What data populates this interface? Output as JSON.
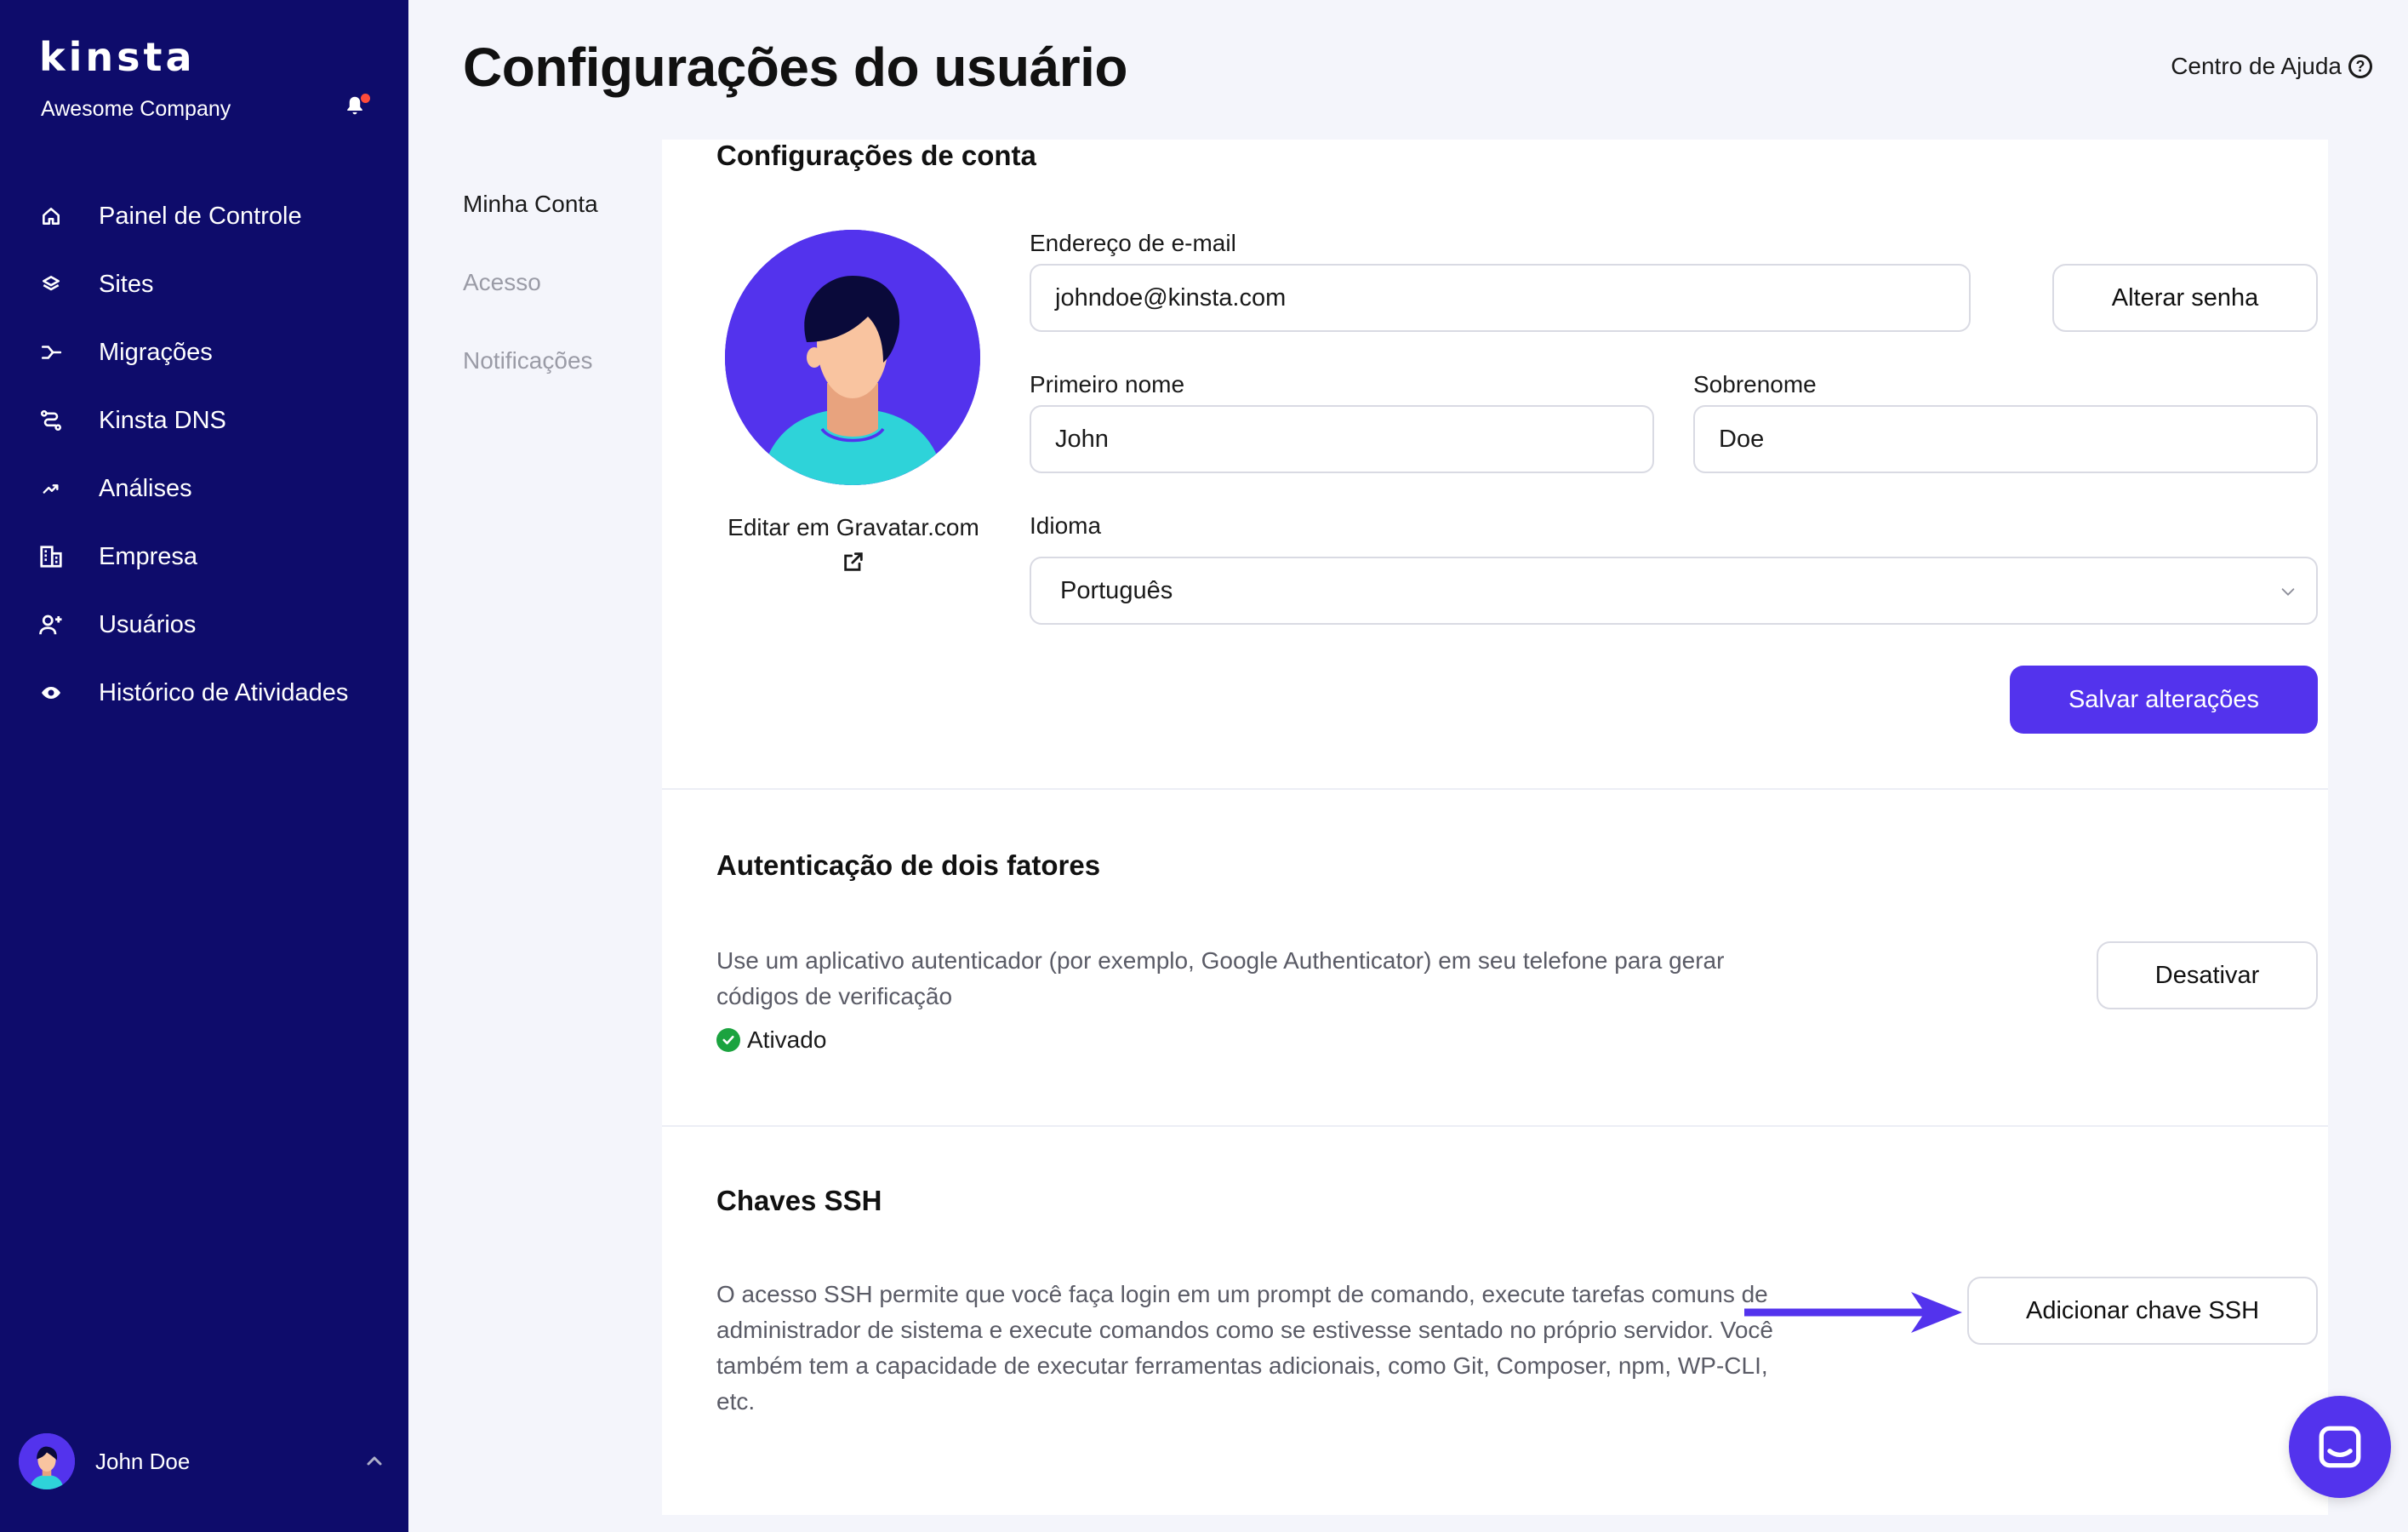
{
  "brand": {
    "logo": "kinsta",
    "company": "Awesome Company",
    "accent_color": "#5333ed",
    "sidebar_color": "#0e0c6b",
    "notification_dot_color": "#ff4b3a"
  },
  "sidebar": {
    "items": [
      {
        "label": "Painel de Controle",
        "icon": "home-icon"
      },
      {
        "label": "Sites",
        "icon": "layers-icon"
      },
      {
        "label": "Migrações",
        "icon": "migration-icon"
      },
      {
        "label": "Kinsta DNS",
        "icon": "dns-icon"
      },
      {
        "label": "Análises",
        "icon": "analytics-icon"
      },
      {
        "label": "Empresa",
        "icon": "building-icon"
      },
      {
        "label": "Usuários",
        "icon": "add-user-icon"
      },
      {
        "label": "Histórico de Atividades",
        "icon": "eye-icon"
      }
    ],
    "user": {
      "name": "John Doe"
    }
  },
  "header": {
    "title": "Configurações do usuário",
    "help_label": "Centro de Ajuda"
  },
  "subnav": {
    "items": [
      {
        "label": "Minha Conta",
        "active": true
      },
      {
        "label": "Acesso",
        "active": false
      },
      {
        "label": "Notificações",
        "active": false
      }
    ]
  },
  "account": {
    "title": "Configurações de conta",
    "gravatar_label": "Editar em Gravatar.com",
    "email_label": "Endereço de e-mail",
    "email_value": "johndoe@kinsta.com",
    "change_password": "Alterar senha",
    "first_name_label": "Primeiro nome",
    "first_name_value": "John",
    "last_name_label": "Sobrenome",
    "last_name_value": "Doe",
    "language_label": "Idioma",
    "language_value": "Português",
    "save_label": "Salvar alterações"
  },
  "two_factor": {
    "title": "Autenticação de dois fatores",
    "description": "Use um aplicativo autenticador (por exemplo, Google Authenticator) em seu telefone para gerar códigos de verificação",
    "status": "Ativado",
    "status_color": "#1ba33f",
    "disable_label": "Desativar"
  },
  "ssh": {
    "title": "Chaves SSH",
    "description": "O acesso SSH permite que você faça login em um prompt de comando, execute tarefas comuns de administrador de sistema e execute comandos como se estivesse sentado no próprio servidor. Você também tem a capacidade de executar ferramentas adicionais, como Git, Composer, npm, WP-CLI, etc.",
    "add_label": "Adicionar chave SSH"
  },
  "chat": {
    "icon": "chat-icon"
  }
}
